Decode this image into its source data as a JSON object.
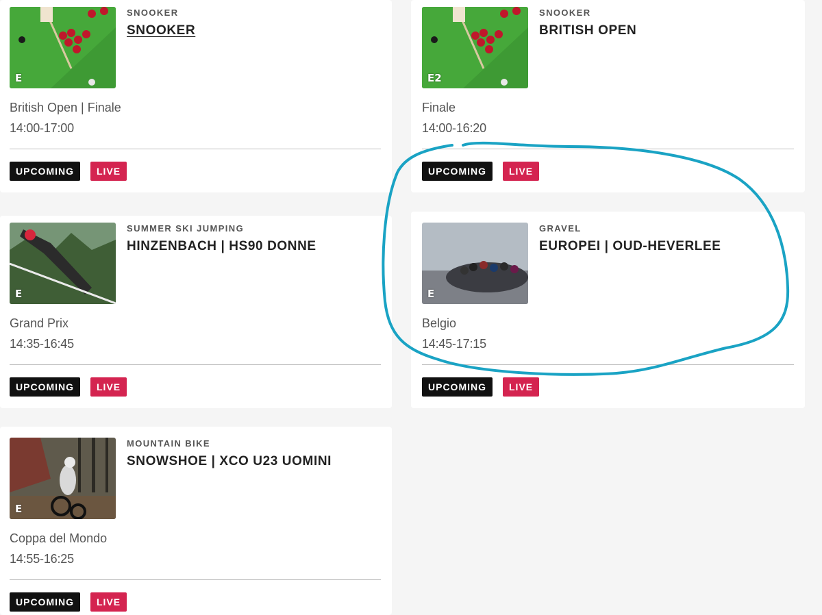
{
  "cards": [
    {
      "sport": "SNOOKER",
      "title": "SNOOKER",
      "subtitle": "British Open | Finale",
      "time": "14:00-17:00",
      "channel_logo": "E",
      "thumbnail": "snooker-table-image",
      "upcoming_label": "UPCOMING",
      "live_label": "LIVE"
    },
    {
      "sport": "SNOOKER",
      "title": "BRITISH OPEN",
      "subtitle": "Finale",
      "time": "14:00-16:20",
      "channel_logo": "E2",
      "thumbnail": "snooker-table-image",
      "upcoming_label": "UPCOMING",
      "live_label": "LIVE"
    },
    {
      "sport": "SUMMER SKI JUMPING",
      "title": "HINZENBACH | HS90 DONNE",
      "subtitle": "Grand Prix",
      "time": "14:35-16:45",
      "channel_logo": "E",
      "thumbnail": "ski-jumper-image",
      "upcoming_label": "UPCOMING",
      "live_label": "LIVE"
    },
    {
      "sport": "GRAVEL",
      "title": "EUROPEI | OUD-HEVERLEE",
      "subtitle": "Belgio",
      "time": "14:45-17:15",
      "channel_logo": "E",
      "thumbnail": "cyclists-peloton-image",
      "upcoming_label": "UPCOMING",
      "live_label": "LIVE"
    },
    {
      "sport": "MOUNTAIN BIKE",
      "title": "SNOWSHOE | XCO U23 UOMINI",
      "subtitle": "Coppa del Mondo",
      "time": "14:55-16:25",
      "channel_logo": "E",
      "thumbnail": "mountain-biker-image",
      "upcoming_label": "UPCOMING",
      "live_label": "LIVE"
    }
  ],
  "colors": {
    "page_background": "#f5f5f5",
    "card_background": "#ffffff",
    "upcoming_badge": "#111111",
    "live_badge": "#d42450",
    "annotation_stroke": "#1aa3c4"
  },
  "annotation": {
    "shape": "freehand-circle",
    "encloses": "EUROPEI | OUD-HEVERLEE"
  }
}
